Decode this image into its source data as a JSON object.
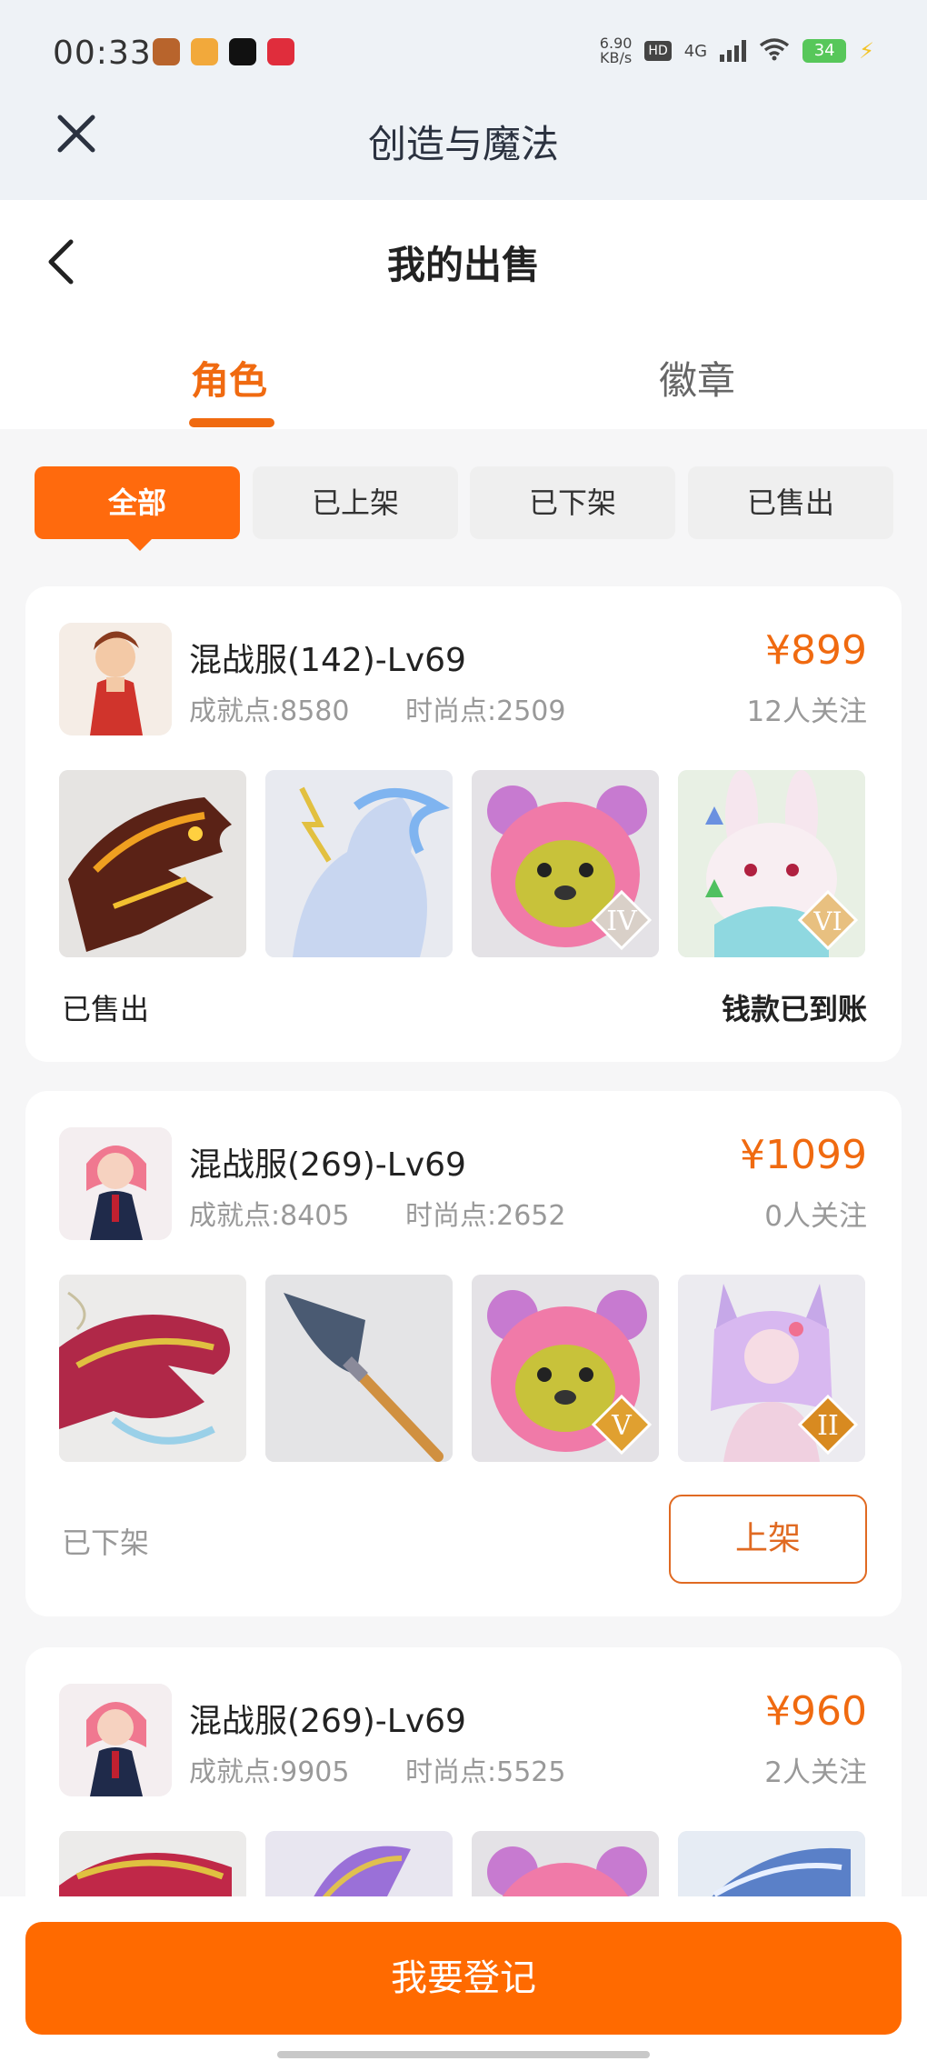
{
  "status_bar": {
    "time": "00:33",
    "net_speed_value": "6.90",
    "net_speed_unit": "KB/s",
    "hd": "HD",
    "signal_label": "4G",
    "battery": "34"
  },
  "top_bar": {
    "app_title": "创造与魔法"
  },
  "header": {
    "page_title": "我的出售"
  },
  "tabs": [
    {
      "label": "角色",
      "active": true
    },
    {
      "label": "徽章",
      "active": false
    }
  ],
  "filters": [
    {
      "label": "全部",
      "active": true
    },
    {
      "label": "已上架",
      "active": false
    },
    {
      "label": "已下架",
      "active": false
    },
    {
      "label": "已售出",
      "active": false
    }
  ],
  "listings": [
    {
      "name": "混战服(142)-Lv69",
      "achievement": "成就点:8580",
      "fashion": "时尚点:2509",
      "price": "¥899",
      "followers": "12人关注",
      "items": [
        "dragon-head",
        "thunder-horse",
        "pink-bear",
        "bunny"
      ],
      "ranks": [
        "",
        "",
        "IV",
        "VI"
      ],
      "status": "已售出",
      "settle": "钱款已到账"
    },
    {
      "name": "混战服(269)-Lv69",
      "achievement": "成就点:8405",
      "fashion": "时尚点:2652",
      "price": "¥1099",
      "followers": "0人关注",
      "items": [
        "red-dragon",
        "spear",
        "pink-bear",
        "fox-girl"
      ],
      "ranks": [
        "",
        "",
        "V",
        "II"
      ],
      "status": "已下架",
      "action": "上架"
    },
    {
      "name": "混战服(269)-Lv69",
      "achievement": "成就点:9905",
      "fashion": "时尚点:5525",
      "price": "¥960",
      "followers": "2人关注",
      "items": [
        "red-dragon",
        "purple-dragon",
        "pink-bear",
        "blue-dragon"
      ]
    }
  ],
  "register_button": "我要登记",
  "colors": {
    "accent": "#ff6a0d",
    "price": "#f06a10",
    "background": "#f6f6f7"
  }
}
